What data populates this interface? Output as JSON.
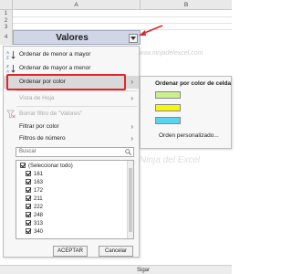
{
  "spreadsheet": {
    "col_a": "A",
    "col_b": "B",
    "row_numbers": [
      "1",
      "2",
      "3",
      "4"
    ],
    "header_value": "Valores",
    "sheet_tab": "Sigar"
  },
  "menu": {
    "sort_asc": "Ordenar de menor a mayor",
    "sort_desc": "Ordenar de mayor a menor",
    "sort_by_color": "Ordenar por color",
    "sheet_view": "Vista de Hoja",
    "clear_filter": "Borrar filtro de \"Valores\"",
    "filter_by_color": "Filtrar por color",
    "number_filters": "Filtros de número",
    "search_placeholder": "Buscar",
    "items": [
      "(Seleccionar todo)",
      "161",
      "163",
      "172",
      "211",
      "222",
      "248",
      "313",
      "340"
    ],
    "ok_label": "ACEPTAR",
    "cancel_label": "Cancelar"
  },
  "submenu": {
    "title": "Ordenar por color de celda",
    "colors": [
      "#c9f08a",
      "#f5f50e",
      "#5ad3f0"
    ],
    "custom_sort": "Orden personalizado..."
  },
  "watermark": "www.ninjadelexcel.com",
  "watermark2": "Ninja del Excel",
  "accent": "#e0262a"
}
